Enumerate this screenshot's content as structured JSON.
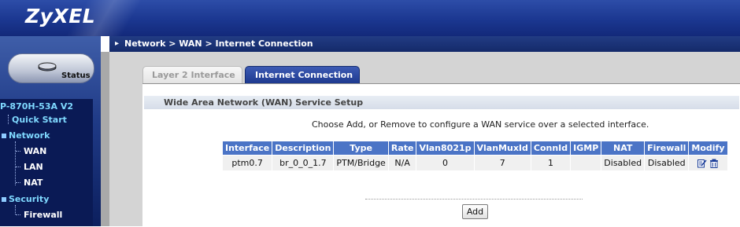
{
  "header": {
    "logo": "ZyXEL"
  },
  "breadcrumb": {
    "text": "Network > WAN > Internet Connection"
  },
  "sidebar": {
    "status_label": "Status",
    "device_name": "P-870H-53A V2",
    "items": [
      {
        "label": "Quick Start"
      },
      {
        "label": "Network"
      },
      {
        "label": "WAN"
      },
      {
        "label": "LAN"
      },
      {
        "label": "NAT"
      },
      {
        "label": "Security"
      },
      {
        "label": "Firewall"
      }
    ]
  },
  "tabs": [
    {
      "label": "Layer 2 Interface",
      "active": false
    },
    {
      "label": "Internet Connection",
      "active": true
    }
  ],
  "section": {
    "title": "Wide Area Network (WAN) Service Setup",
    "instruction": "Choose Add, or Remove to configure a WAN service over a selected interface."
  },
  "table": {
    "headers": [
      "Interface",
      "Description",
      "Type",
      "Rate",
      "Vlan8021p",
      "VlanMuxId",
      "ConnId",
      "IGMP",
      "NAT",
      "Firewall",
      "Modify"
    ],
    "rows": [
      [
        "ptm0.7",
        "br_0_0_1.7",
        "PTM/Bridge",
        "N/A",
        "0",
        "7",
        "1",
        "",
        "Disabled",
        "Disabled"
      ]
    ]
  },
  "actions": {
    "add_label": "Add"
  },
  "colors": {
    "header_blue": "#1b3790",
    "table_header": "#4b74c6",
    "tab_active": "#1e3a8f",
    "nav_cyan": "#7fd9ff"
  }
}
